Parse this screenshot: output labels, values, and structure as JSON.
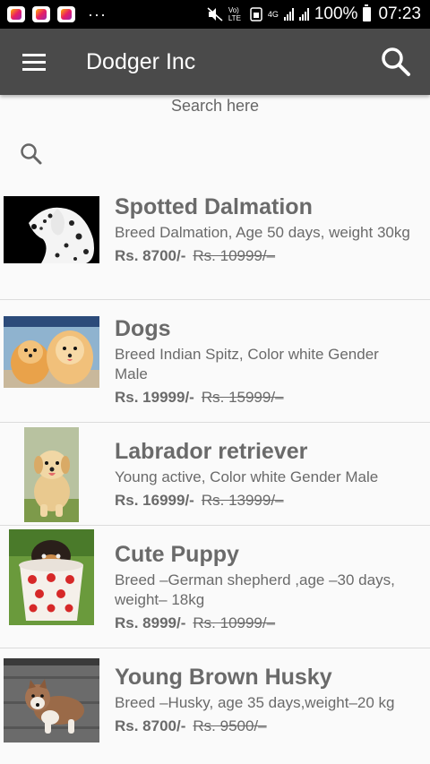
{
  "status_bar": {
    "battery": "100%",
    "time": "07:23",
    "network": "4G",
    "volte": "Vo) LTE",
    "more": "···"
  },
  "appbar": {
    "title": "Dodger Inc",
    "menu_icon": "hamburger-menu-icon",
    "search_icon": "search-icon"
  },
  "search": {
    "label": "Search here",
    "placeholder": ""
  },
  "products": [
    {
      "name": "Spotted Dalmation",
      "description": "Breed Dalmation, Age 50 days, weight 30kg",
      "price": "Rs. 8700/-",
      "old_price": "Rs. 10999/–"
    },
    {
      "name": "Dogs",
      "description": "Breed Indian Spitz, Color white Gender Male",
      "price": "Rs. 19999/-",
      "old_price": "Rs. 15999/–"
    },
    {
      "name": "Labrador retriever",
      "description": "Young active, Color white Gender Male",
      "price": "Rs. 16999/-",
      "old_price": "Rs. 13999/–"
    },
    {
      "name": "Cute Puppy",
      "description": "Breed –German shepherd ,age –30 days, weight– 18kg",
      "price": "Rs. 8999/-",
      "old_price": "Rs. 10999/–"
    },
    {
      "name": "Young Brown Husky",
      "description": "Breed –Husky, age 35 days,weight–20 kg",
      "price": "Rs. 8700/-",
      "old_price": "Rs. 9500/–"
    }
  ]
}
